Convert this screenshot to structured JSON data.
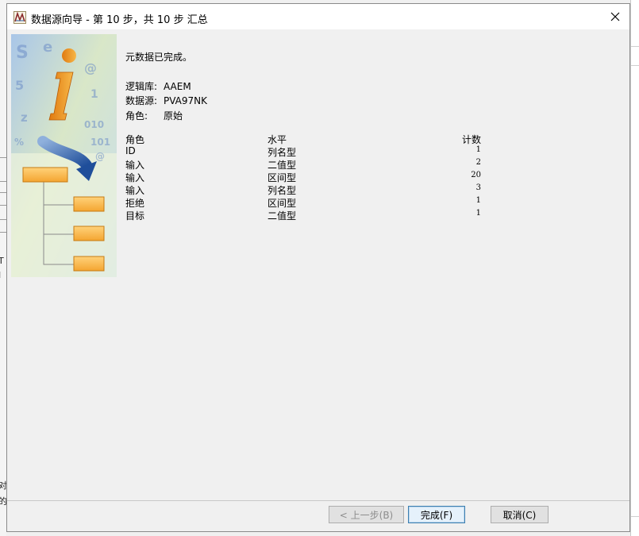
{
  "window": {
    "title": "数据源向导 - 第 10 步，共 10 步 汇总",
    "app_icon": "sas-miner-icon",
    "close_icon": "close-icon"
  },
  "message": "元数据已完成。",
  "info": [
    {
      "key": "逻辑库:",
      "value": "AAEM"
    },
    {
      "key": "数据源:",
      "value": "PVA97NK"
    },
    {
      "key": "角色:",
      "value": "原始"
    }
  ],
  "table": {
    "headers": [
      "角色",
      "水平",
      "计数"
    ],
    "rows": [
      [
        "ID",
        "列名型",
        "1"
      ],
      [
        "输入",
        "二值型",
        "2"
      ],
      [
        "输入",
        "区间型",
        "20"
      ],
      [
        "输入",
        "列名型",
        "3"
      ],
      [
        "拒绝",
        "区间型",
        "1"
      ],
      [
        "目标",
        "二值型",
        "1"
      ]
    ]
  },
  "buttons": {
    "back": "< 上一步(B)",
    "finish": "完成(F)",
    "cancel": "取消(C)"
  },
  "background_fragments": [
    "T",
    "I",
    "对",
    "的"
  ]
}
